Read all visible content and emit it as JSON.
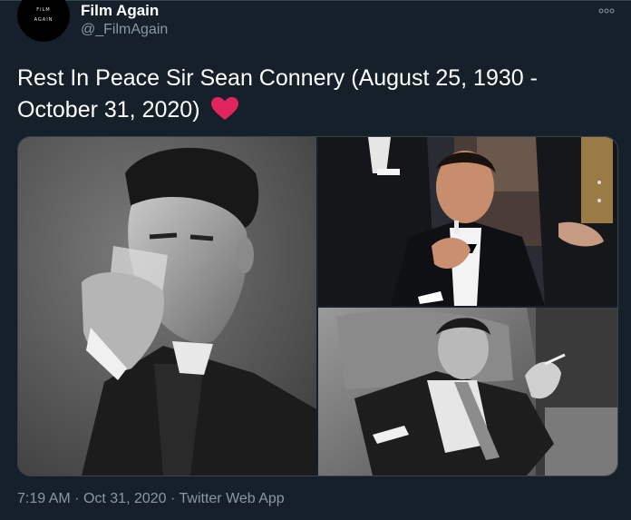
{
  "author": {
    "name": "Film Again",
    "handle": "@_FilmAgain",
    "avatar_text_line1": "FILM",
    "avatar_text_line2": "AGAIN"
  },
  "more_icon": "more-dots-icon",
  "tweet": {
    "text": "Rest In Peace Sir Sean Connery (August 25, 1930 - October 31, 2020)",
    "emoji": "heart-emoji",
    "emoji_color": "#e0245e"
  },
  "media": {
    "count": 3,
    "photos": [
      {
        "name": "photo-portrait-drinking",
        "tone": "black-and-white"
      },
      {
        "name": "photo-tuxedo-lighter",
        "tone": "color"
      },
      {
        "name": "photo-reclining-armchair",
        "tone": "black-and-white"
      }
    ]
  },
  "timestamp": {
    "time": "7:19 AM",
    "date": "Oct 31, 2020",
    "separator": "·",
    "source": "Twitter Web App"
  },
  "colors": {
    "background": "#15202b",
    "text_primary": "#ffffff",
    "text_secondary": "#8899a6",
    "border": "#38444d"
  }
}
